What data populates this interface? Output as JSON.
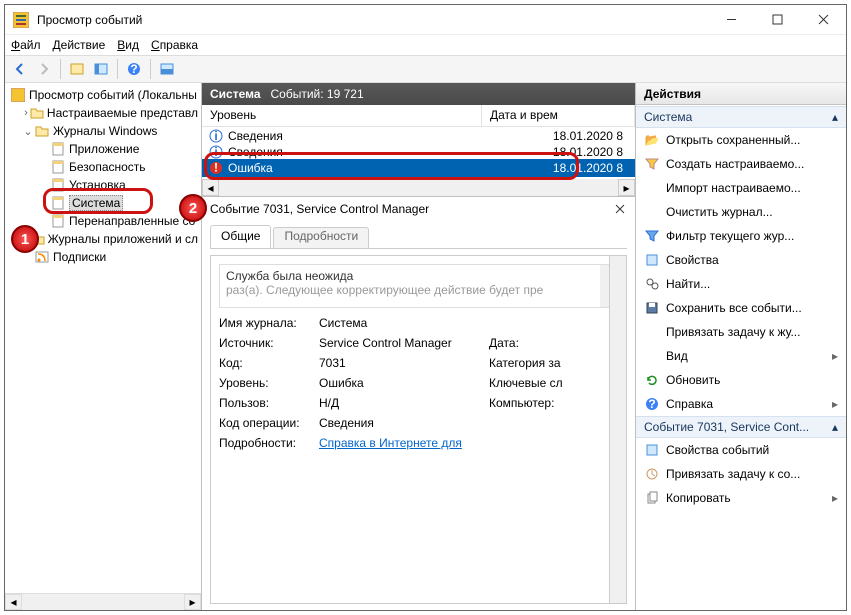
{
  "window": {
    "title": "Просмотр событий"
  },
  "menu": {
    "file": "Файл",
    "action": "Действие",
    "view": "Вид",
    "help": "Справка"
  },
  "tree": {
    "root": "Просмотр событий (Локальны",
    "custom": "Настраиваемые представл",
    "winlogs": "Журналы Windows",
    "app": "Приложение",
    "security": "Безопасность",
    "setup": "Установка",
    "system": "Система",
    "forwarded": "Перенаправленные со",
    "appsvc": "Журналы приложений и сл",
    "subs": "Подписки"
  },
  "center": {
    "title": "Система",
    "count_label": "Событий: 19 721",
    "col_level": "Уровень",
    "col_date": "Дата и врем",
    "rows": [
      {
        "level": "Сведения",
        "date": "18.01.2020 8",
        "type": "info"
      },
      {
        "level": "Сведения",
        "date": "18.01.2020 8",
        "type": "info"
      },
      {
        "level": "Ошибка",
        "date": "18.01.2020 8",
        "type": "error"
      }
    ]
  },
  "detail": {
    "title": "Событие 7031, Service Control Manager",
    "tab_general": "Общие",
    "tab_details": "Подробности",
    "message_l1": "Служба                                                              была неожида",
    "message_l2": "раз(а). Следующее корректирующее действие будет пре",
    "fields": {
      "log_name_k": "Имя журнала:",
      "log_name_v": "Система",
      "source_k": "Источник:",
      "source_v": "Service Control Manager",
      "date_k": "Дата:",
      "eventid_k": "Код:",
      "eventid_v": "7031",
      "category_k": "Категория за",
      "level_k": "Уровень:",
      "level_v": "Ошибка",
      "keywords_k": "Ключевые сл",
      "user_k": "Пользов:",
      "user_v": "Н/Д",
      "computer_k": "Компьютер:",
      "opcode_k": "Код операции:",
      "opcode_v": "Сведения",
      "more_k": "Подробности:",
      "more_v": "Справка в Интернете для "
    }
  },
  "actions": {
    "header": "Действия",
    "section1": "Система",
    "items1": [
      "Открыть сохраненный...",
      "Создать настраиваемо...",
      "Импорт настраиваемо...",
      "Очистить журнал...",
      "Фильтр текущего жур...",
      "Свойства",
      "Найти...",
      "Сохранить все событи...",
      "Привязать задачу к жу..."
    ],
    "view": "Вид",
    "refresh": "Обновить",
    "help": "Справка",
    "section2": "Событие 7031, Service Cont...",
    "items2": [
      "Свойства событий",
      "Привязать задачу к со...",
      "Копировать"
    ]
  },
  "badges": {
    "b1": "1",
    "b2": "2"
  }
}
